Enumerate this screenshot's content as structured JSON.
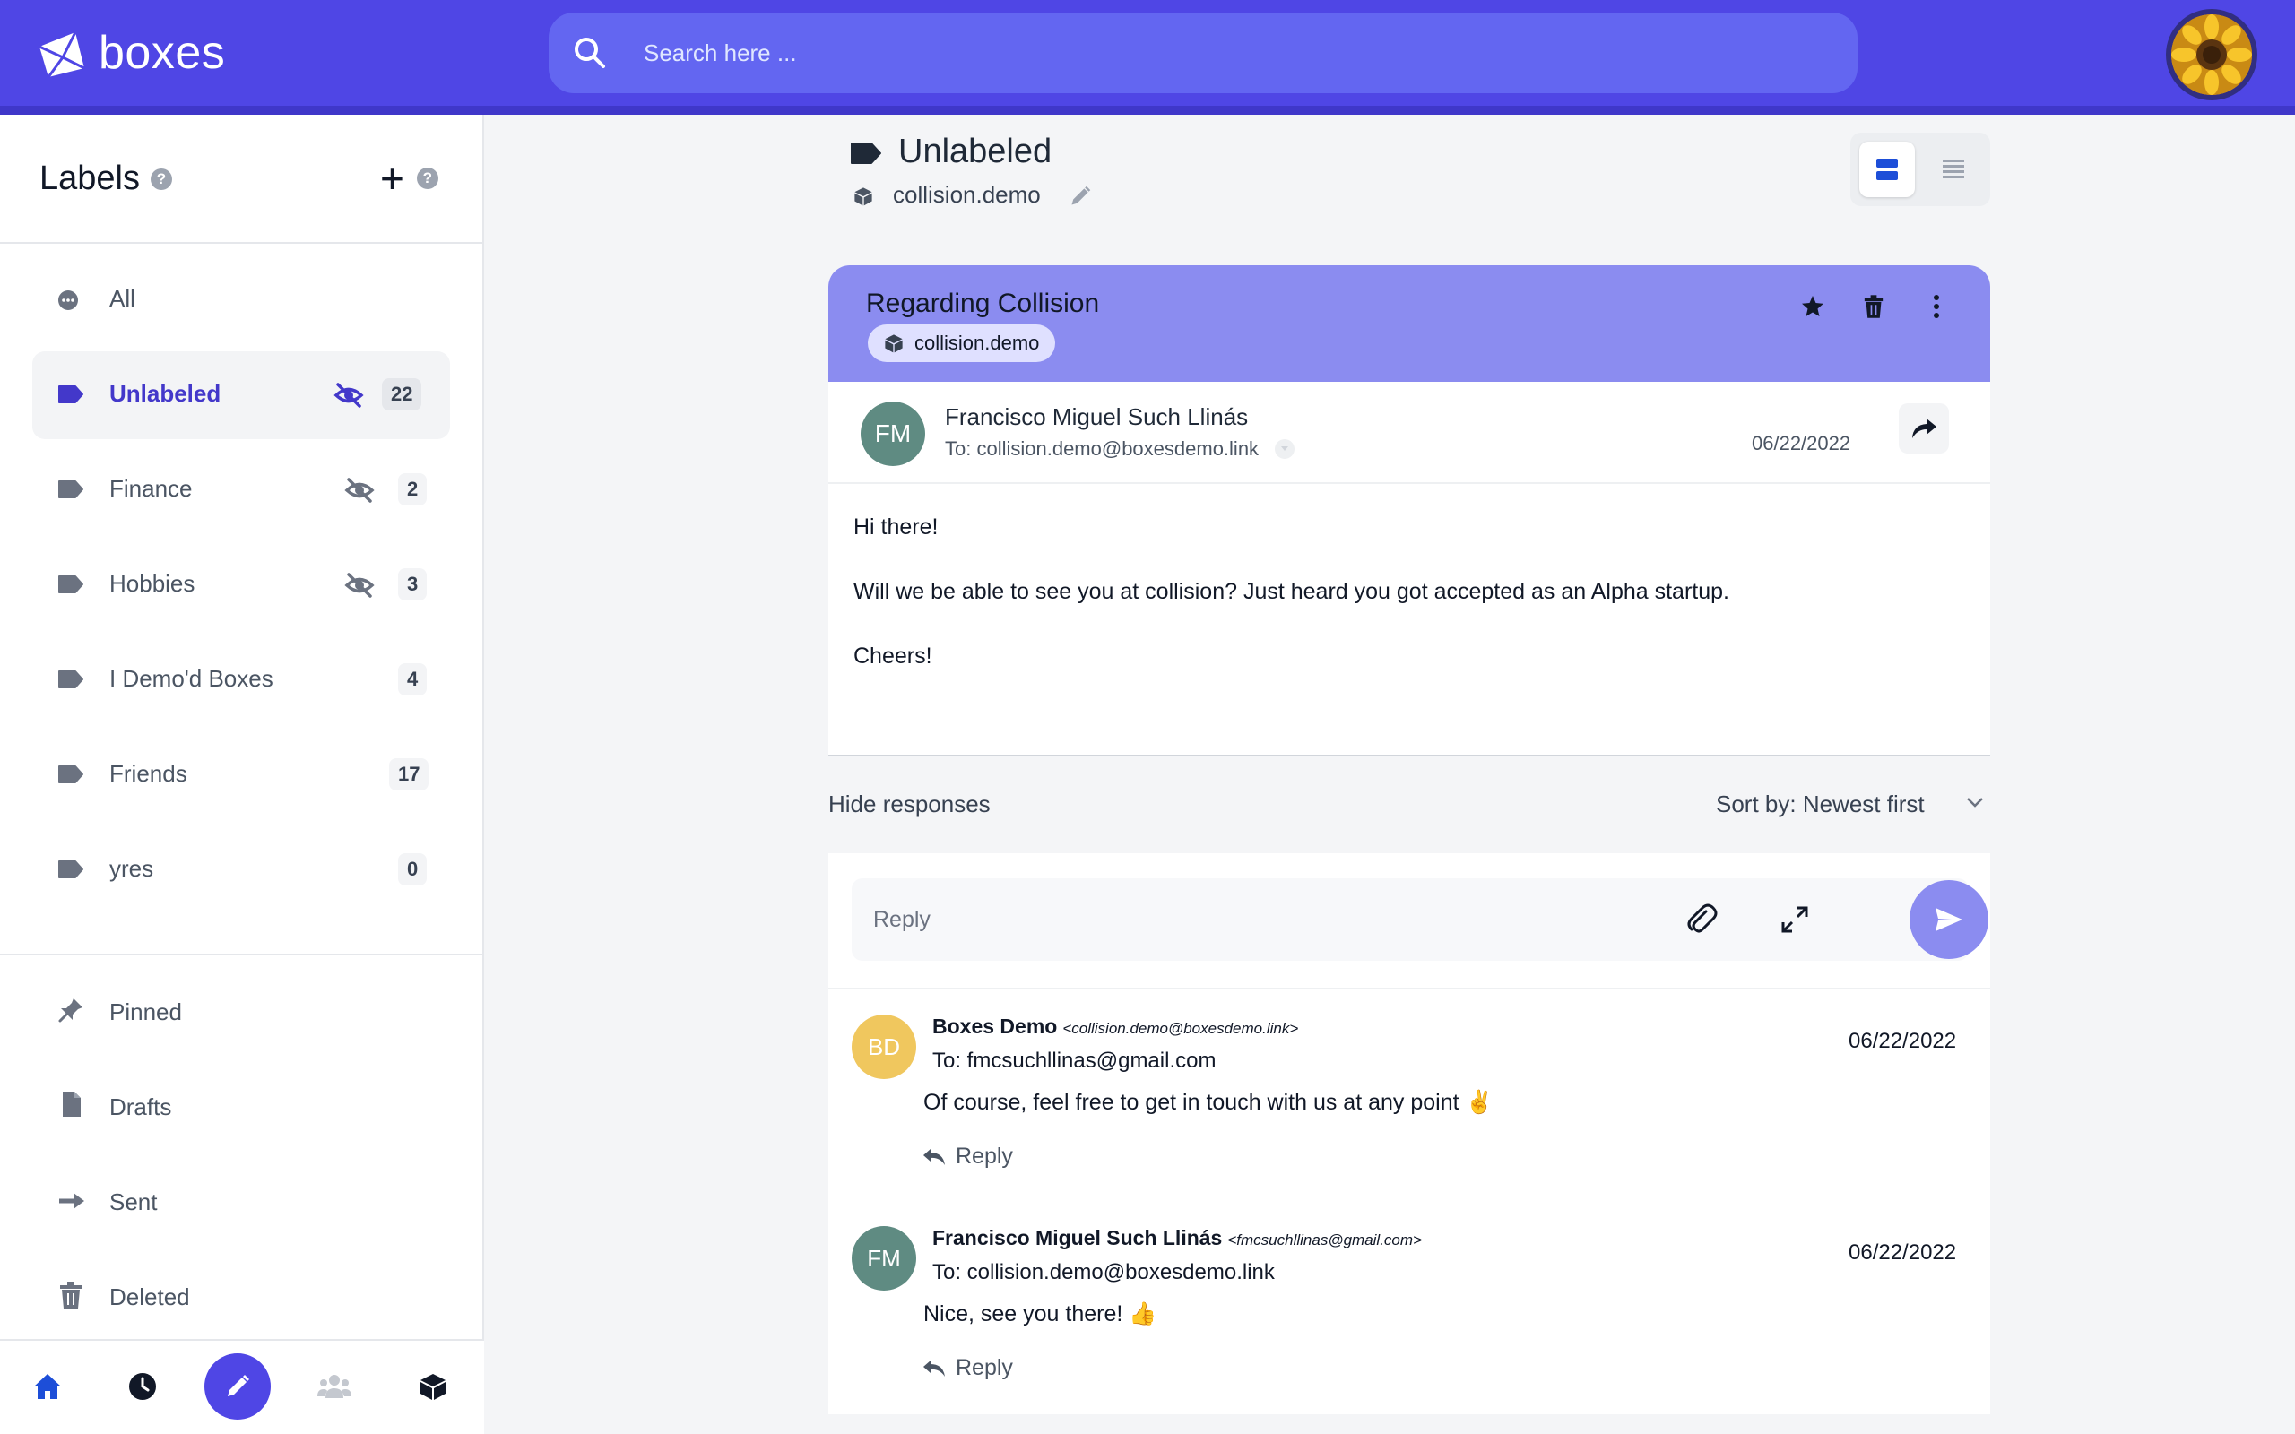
{
  "app": {
    "name": "boxes"
  },
  "search": {
    "placeholder": "Search here ..."
  },
  "sidebar": {
    "title": "Labels",
    "labels": [
      {
        "name": "All",
        "count": null,
        "hidden": false,
        "active": false
      },
      {
        "name": "Unlabeled",
        "count": "22",
        "hidden": true,
        "active": true
      },
      {
        "name": "Finance",
        "count": "2",
        "hidden": true,
        "active": false
      },
      {
        "name": "Hobbies",
        "count": "3",
        "hidden": true,
        "active": false
      },
      {
        "name": "I Demo'd Boxes",
        "count": "4",
        "hidden": false,
        "active": false
      },
      {
        "name": "Friends",
        "count": "17",
        "hidden": false,
        "active": false
      },
      {
        "name": "yres",
        "count": "0",
        "hidden": false,
        "active": false
      }
    ],
    "system": [
      {
        "name": "Pinned",
        "icon": "pin-icon"
      },
      {
        "name": "Drafts",
        "icon": "document-icon"
      },
      {
        "name": "Sent",
        "icon": "arrow-right-icon"
      },
      {
        "name": "Deleted",
        "icon": "trash-icon"
      }
    ],
    "bottom_nav": [
      "home-icon",
      "clock-icon",
      "pencil-icon",
      "people-icon",
      "cube-icon"
    ]
  },
  "main": {
    "title": "Unlabeled",
    "box": "collision.demo",
    "thread": {
      "subject": "Regarding Collision",
      "tag": "collision.demo",
      "message": {
        "initials": "FM",
        "sender": "Francisco Miguel Such Llinás",
        "to": "To: collision.demo@boxesdemo.link",
        "date": "06/22/2022",
        "body": [
          "Hi there!",
          "Will we be able to see you at collision? Just heard you got accepted as an Alpha startup.",
          "Cheers!"
        ]
      }
    },
    "hide_responses": "Hide responses",
    "sort_label": "Sort by: Newest first",
    "reply_placeholder": "Reply",
    "responses": [
      {
        "initials": "BD",
        "name": "Boxes Demo",
        "email": "<collision.demo@boxesdemo.link>",
        "to": "To: fmcsuchllinas@gmail.com",
        "date": "06/22/2022",
        "text": "Of course, feel free to get in touch with us at any point ✌️",
        "reply_label": "Reply",
        "color": "#f0c75e"
      },
      {
        "initials": "FM",
        "name": "Francisco Miguel Such Llinás",
        "email": "<fmcsuchllinas@gmail.com>",
        "to": "To: collision.demo@boxesdemo.link",
        "date": "06/22/2022",
        "text": "Nice, see you there! 👍",
        "reply_label": "Reply",
        "color": "#5f8b82"
      }
    ]
  },
  "colors": {
    "brand": "#4f46e5",
    "thread_header": "#8b8cf0",
    "active_label": "#4338ca"
  }
}
